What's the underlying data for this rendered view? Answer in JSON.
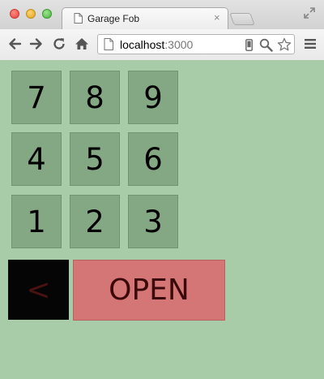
{
  "browser": {
    "tab_title": "Garage Fob",
    "tab_close_glyph": "×",
    "url_host": "localhost",
    "url_port": ":3000",
    "icons": [
      "back-arrow-icon",
      "forward-arrow-icon",
      "reload-icon",
      "home-icon",
      "document-icon",
      "mobile-device-icon",
      "zoom-icon",
      "bookmark-star-icon",
      "menu-icon",
      "fullscreen-icon"
    ]
  },
  "keypad": {
    "keys": [
      {
        "label": "7"
      },
      {
        "label": "8"
      },
      {
        "label": "9"
      },
      {
        "label": "4"
      },
      {
        "label": "5"
      },
      {
        "label": "6"
      },
      {
        "label": "1"
      },
      {
        "label": "2"
      },
      {
        "label": "3"
      }
    ],
    "back_label": "<",
    "open_label": "OPEN"
  },
  "colors": {
    "page_background": "#a8cba8",
    "key_background": "#83a883",
    "back_background": "#050505",
    "open_background": "#d57676",
    "open_text": "#3a0a0a"
  }
}
